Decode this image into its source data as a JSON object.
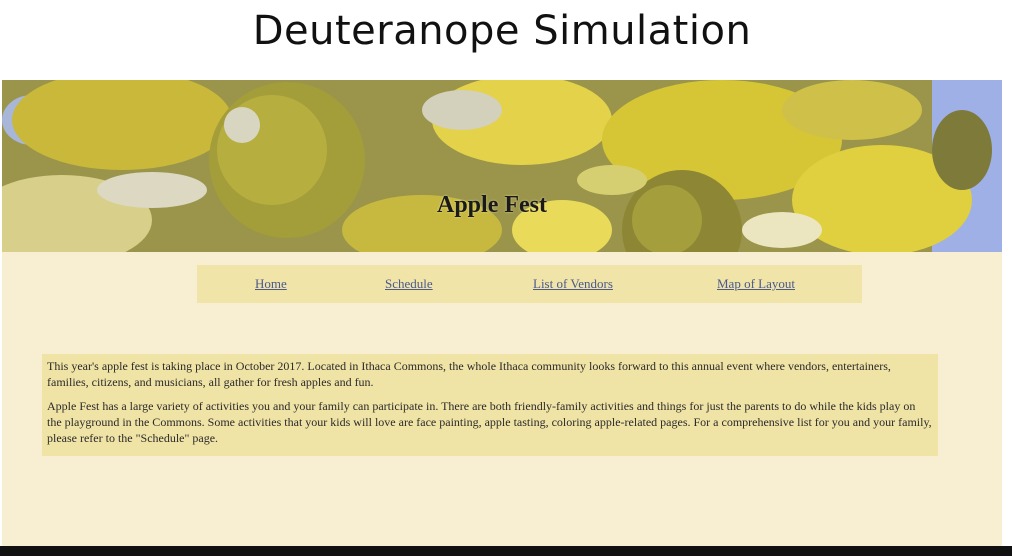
{
  "caption": "Deuteranope Simulation",
  "hero": {
    "title": "Apple Fest"
  },
  "nav": {
    "items": [
      {
        "label": "Home"
      },
      {
        "label": "Schedule"
      },
      {
        "label": "List of Vendors"
      },
      {
        "label": "Map of Layout"
      }
    ]
  },
  "content": {
    "paragraphs": [
      "This year's apple fest is taking place in October 2017. Located in Ithaca Commons, the whole Ithaca community looks forward to this annual event where vendors, entertainers, families, citizens, and musicians, all gather for fresh apples and fun.",
      "Apple Fest has a large variety of activities you and your family can participate in. There are both friendly-family activities and things for just the parents to do while the kids play on the playground in the Commons. Some activities that your kids will love are face painting, apple tasting, coloring apple-related pages. For a comprehensive list for you and your family, please refer to the \"Schedule\" page."
    ]
  },
  "colors": {
    "page_background": "#f8efd2",
    "nav_background": "#f1e4a8",
    "content_background": "#f0e3a6",
    "link": "#4b5a8c"
  }
}
